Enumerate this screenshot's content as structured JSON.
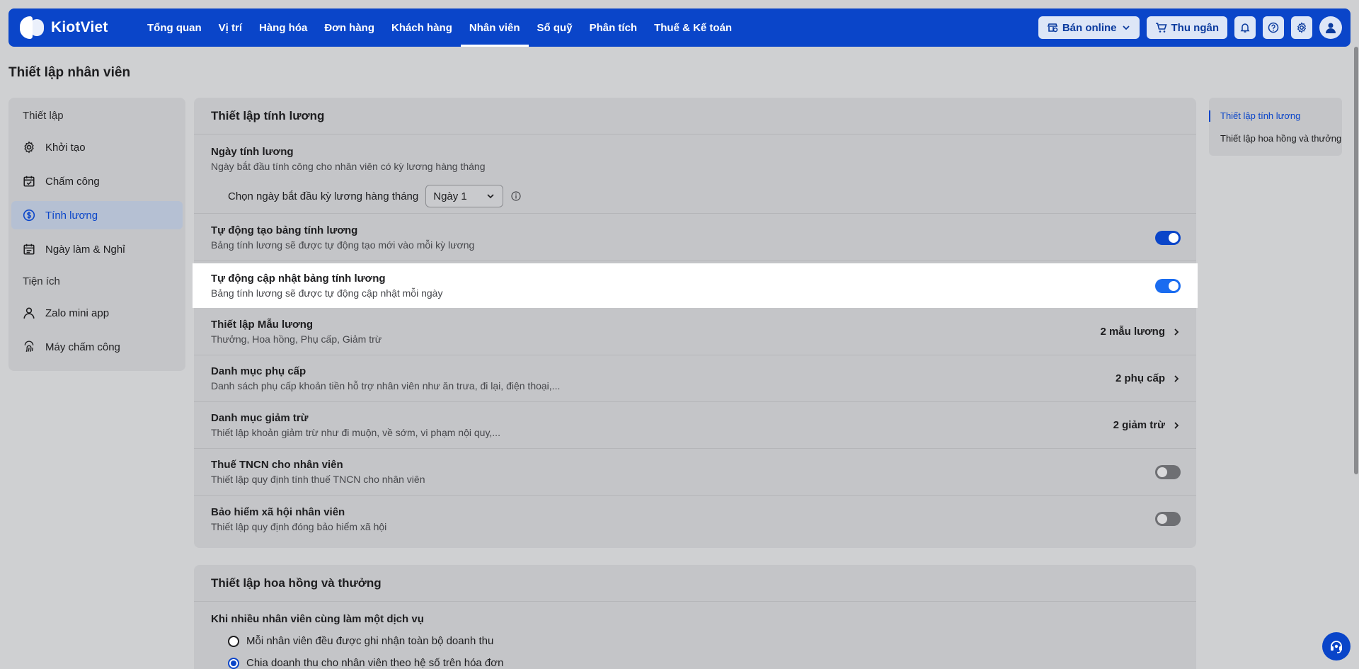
{
  "brand": {
    "name": "KiotViet"
  },
  "nav": {
    "items": [
      {
        "label": "Tổng quan"
      },
      {
        "label": "Vị trí"
      },
      {
        "label": "Hàng hóa"
      },
      {
        "label": "Đơn hàng"
      },
      {
        "label": "Khách hàng"
      },
      {
        "label": "Nhân viên",
        "active": true
      },
      {
        "label": "Sổ quỹ"
      },
      {
        "label": "Phân tích"
      },
      {
        "label": "Thuế & Kế toán"
      }
    ]
  },
  "top_actions": {
    "sell_online": "Bán online",
    "cashier": "Thu ngân",
    "icons": [
      "bell-icon",
      "help-icon",
      "gear-icon",
      "user-avatar-icon"
    ]
  },
  "page": {
    "title": "Thiết lập nhân viên"
  },
  "sidebar": {
    "section1": "Thiết lập",
    "items1": [
      {
        "label": "Khởi tạo",
        "icon": "gear-icon"
      },
      {
        "label": "Chấm công",
        "icon": "calendar-check-icon"
      },
      {
        "label": "Tính lương",
        "icon": "dollar-circle-icon",
        "active": true
      },
      {
        "label": "Ngày làm & Nghỉ",
        "icon": "calendar-icon"
      }
    ],
    "section2": "Tiện ích",
    "items2": [
      {
        "label": "Zalo mini app",
        "icon": "user-icon"
      },
      {
        "label": "Máy chấm công",
        "icon": "fingerprint-icon"
      }
    ]
  },
  "payroll": {
    "title": "Thiết lập tính lương",
    "pay_day": {
      "title": "Ngày tính lương",
      "desc": "Ngày bắt đầu tính công cho nhân viên có kỳ lương hàng tháng",
      "select_label": "Chọn ngày bắt đầu kỳ lương hàng tháng",
      "select_value": "Ngày 1"
    },
    "auto_create": {
      "title": "Tự động tạo bảng tính lương",
      "desc": "Bảng tính lương sẽ được tự động tạo mới vào mỗi kỳ lương",
      "enabled": true
    },
    "auto_update": {
      "title": "Tự động cập nhật bảng tính lương",
      "desc": "Bảng tính lương sẽ được tự động cập nhật mỗi ngày",
      "enabled": true
    },
    "templates": {
      "title": "Thiết lập Mẫu lương",
      "desc": "Thưởng, Hoa hồng, Phụ cấp, Giảm trừ",
      "value": "2 mẫu lương"
    },
    "allowances": {
      "title": "Danh mục phụ cấp",
      "desc": "Danh sách phụ cấp khoản tiền hỗ trợ nhân viên như ăn trưa, đi lại, điện thoại,...",
      "value": "2 phụ cấp"
    },
    "deductions": {
      "title": "Danh mục giảm trừ",
      "desc": "Thiết lập khoản giảm trừ như đi muộn, về sớm, vi phạm nội quy,...",
      "value": "2 giảm trừ"
    },
    "pit": {
      "title": "Thuế TNCN cho nhân viên",
      "desc": "Thiết lập quy định tính thuế TNCN cho nhân viên",
      "enabled": false
    },
    "insurance": {
      "title": "Bảo hiểm xã hội nhân viên",
      "desc": "Thiết lập quy định đóng bảo hiểm xã hội",
      "enabled": false
    }
  },
  "commission": {
    "title": "Thiết lập hoa hồng và thưởng",
    "question": "Khi nhiều nhân viên cùng làm một dịch vụ",
    "options": [
      {
        "label": "Mỗi nhân viên đều được ghi nhận toàn bộ doanh thu",
        "checked": false
      },
      {
        "label": "Chia doanh thu cho nhân viên theo hệ số trên hóa đơn",
        "checked": true
      }
    ]
  },
  "anchors": {
    "items": [
      {
        "label": "Thiết lập tính lương",
        "active": true
      },
      {
        "label": "Thiết lập hoa hồng và thưởng"
      }
    ]
  },
  "colors": {
    "primary": "#0a45c9",
    "toggle_on": "#1a6cf0",
    "toggle_off": "#6e6f73"
  }
}
